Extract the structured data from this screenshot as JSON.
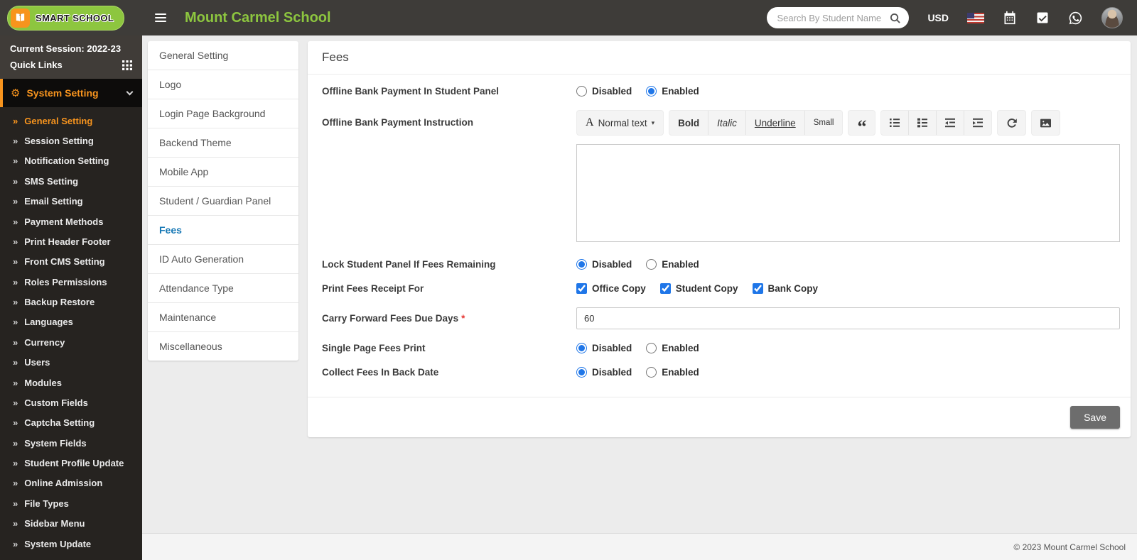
{
  "header": {
    "brand": "SMART SCHOOL",
    "school_name": "Mount Carmel School",
    "search_placeholder": "Search By Student Name",
    "currency": "USD",
    "icons": [
      "hamburger-icon",
      "search-icon",
      "us-flag-icon",
      "calendar-icon",
      "task-check-icon",
      "whatsapp-icon",
      "user-avatar"
    ]
  },
  "sidebar": {
    "session_label": "Current Session: 2022-23",
    "quick_links_label": "Quick Links",
    "menu_title": "System Setting",
    "gear_glyph": "⚙",
    "item_chevron": "»",
    "items": [
      {
        "label": "General Setting",
        "active": true
      },
      {
        "label": "Session Setting"
      },
      {
        "label": "Notification Setting"
      },
      {
        "label": "SMS Setting"
      },
      {
        "label": "Email Setting"
      },
      {
        "label": "Payment Methods"
      },
      {
        "label": "Print Header Footer"
      },
      {
        "label": "Front CMS Setting"
      },
      {
        "label": "Roles Permissions"
      },
      {
        "label": "Backup Restore"
      },
      {
        "label": "Languages"
      },
      {
        "label": "Currency"
      },
      {
        "label": "Users"
      },
      {
        "label": "Modules"
      },
      {
        "label": "Custom Fields"
      },
      {
        "label": "Captcha Setting"
      },
      {
        "label": "System Fields"
      },
      {
        "label": "Student Profile Update"
      },
      {
        "label": "Online Admission"
      },
      {
        "label": "File Types"
      },
      {
        "label": "Sidebar Menu"
      },
      {
        "label": "System Update"
      }
    ]
  },
  "tabs": {
    "items": [
      {
        "label": "General Setting"
      },
      {
        "label": "Logo"
      },
      {
        "label": "Login Page Background"
      },
      {
        "label": "Backend Theme"
      },
      {
        "label": "Mobile App"
      },
      {
        "label": "Student / Guardian Panel"
      },
      {
        "label": "Fees",
        "active": true
      },
      {
        "label": "ID Auto Generation"
      },
      {
        "label": "Attendance Type"
      },
      {
        "label": "Maintenance"
      },
      {
        "label": "Miscellaneous"
      }
    ]
  },
  "form": {
    "title": "Fees",
    "editor": {
      "style_letter": "A",
      "style_label": "Normal text",
      "caret": "▾",
      "buttons": [
        "Bold",
        "Italic",
        "Underline",
        "Small"
      ],
      "quote_glyph": "“",
      "icons": [
        "quote-icon",
        "ordered-list-icon",
        "unordered-list-icon",
        "outdent-icon",
        "indent-icon",
        "redo-icon",
        "image-icon"
      ]
    },
    "rows": [
      {
        "label": "Offline Bank Payment In Student Panel",
        "options": [
          {
            "label": "Disabled",
            "checked": false
          },
          {
            "label": "Enabled",
            "checked": true
          }
        ]
      },
      {
        "label": "Offline Bank Payment Instruction",
        "value": ""
      },
      {
        "label": "Lock Student Panel If Fees Remaining",
        "options": [
          {
            "label": "Disabled",
            "checked": true
          },
          {
            "label": "Enabled",
            "checked": false
          }
        ]
      },
      {
        "label": "Print Fees Receipt For",
        "options": [
          {
            "label": "Office Copy",
            "checked": true
          },
          {
            "label": "Student Copy",
            "checked": true
          },
          {
            "label": "Bank Copy",
            "checked": true
          }
        ]
      },
      {
        "label": "Carry Forward Fees Due Days",
        "required_mark": "*",
        "value": "60"
      },
      {
        "label": "Single Page Fees Print",
        "options": [
          {
            "label": "Disabled",
            "checked": true
          },
          {
            "label": "Enabled",
            "checked": false
          }
        ]
      },
      {
        "label": "Collect Fees In Back Date",
        "options": [
          {
            "label": "Disabled",
            "checked": true
          },
          {
            "label": "Enabled",
            "checked": false
          }
        ]
      }
    ],
    "save_label": "Save"
  },
  "footer": {
    "copyright": "© 2023 Mount Carmel School"
  },
  "colors": {
    "header_bg": "#3e3c39",
    "brand_green": "#8dc63f",
    "accent_orange": "#f7941e",
    "active_tab_blue": "#1778b5",
    "control_blue": "#1f76e8",
    "save_gray": "#6d6d6d"
  }
}
